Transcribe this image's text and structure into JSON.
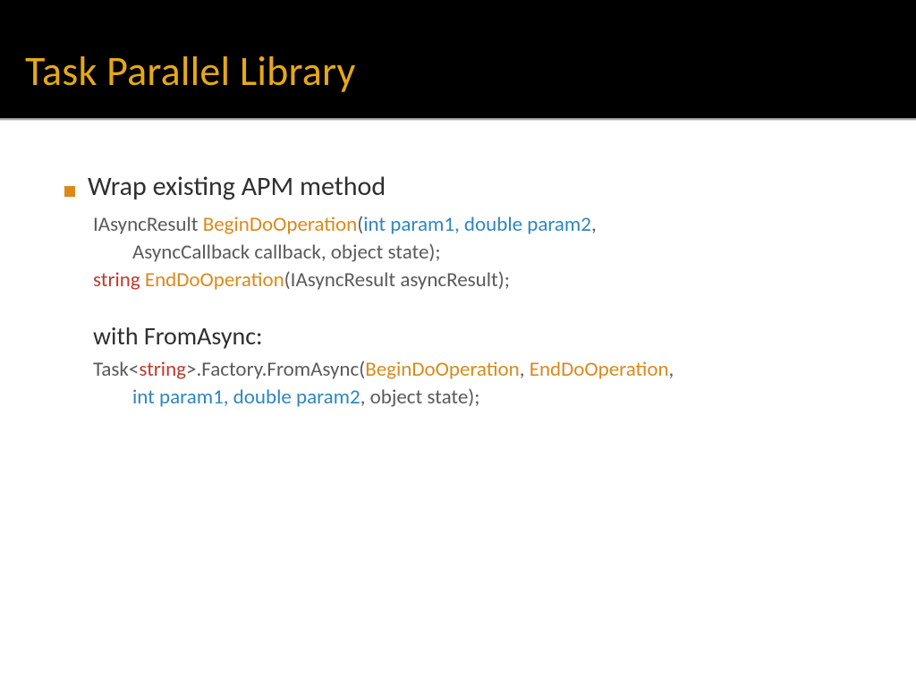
{
  "slide": {
    "title": "Task Parallel Library",
    "bullet": "Wrap existing APM method",
    "sig1": {
      "ret": "IAsyncResult ",
      "name": "BeginDoOperation",
      "lp": "(",
      "params_typed": "int param1, double param2",
      "comma": ",",
      "cont": "AsyncCallback callback, object state);"
    },
    "sig2": {
      "ret": "string",
      "sp": " ",
      "name": "EndDoOperation",
      "rest": "(IAsyncResult asyncResult);"
    },
    "with_label": "with FromAsync:",
    "from": {
      "p1": "Task<",
      "p2": "string",
      "p3": ">.Factory.FromAsync(",
      "p4": "BeginDoOperation",
      "p5": ", ",
      "p6": "EndDoOperation",
      "p7": ",",
      "p8": "int param1, double param2",
      "p9": ", object state);"
    }
  },
  "colors": {
    "title": "#e6a817",
    "bullet_square": "#d98a1b",
    "accent_orange": "#d98a1b",
    "accent_red": "#c0392b",
    "accent_blue": "#2e86c1"
  }
}
